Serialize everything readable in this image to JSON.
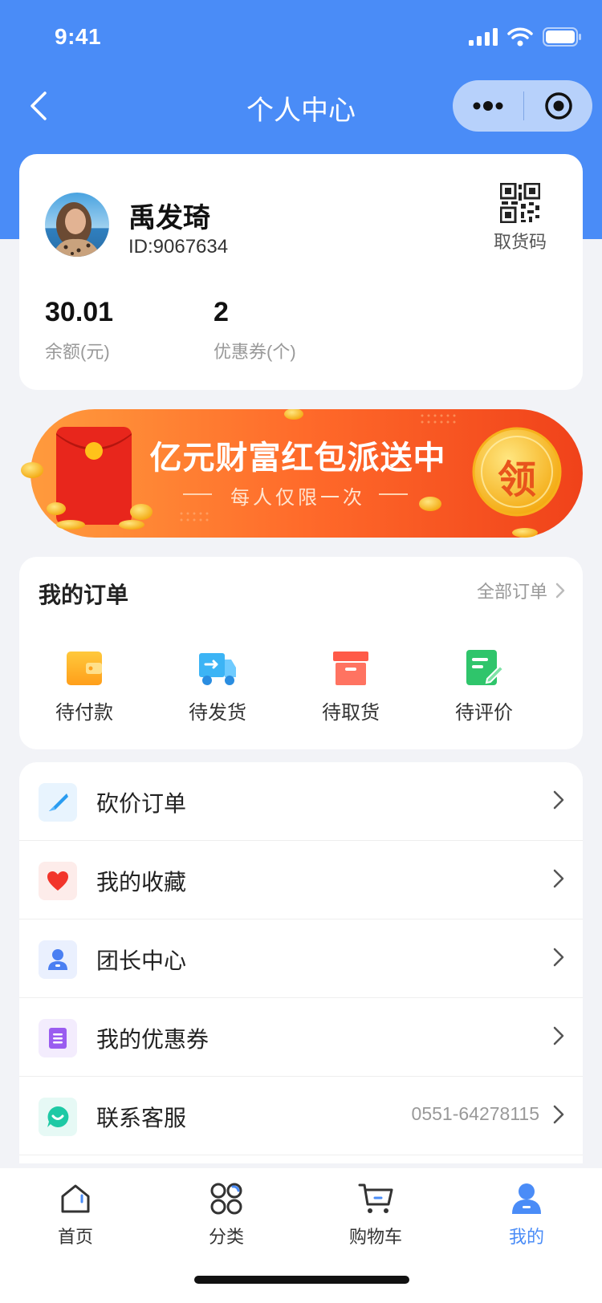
{
  "status": {
    "time": "9:41"
  },
  "nav": {
    "title": "个人中心"
  },
  "profile": {
    "name": "禹发琦",
    "id": "ID:9067634",
    "qr_label": "取货码",
    "balance_value": "30.01",
    "balance_label": "余额(元)",
    "coupon_value": "2",
    "coupon_label": "优惠券(个)"
  },
  "banner": {
    "title": "亿元财富红包派送中",
    "subtitle": "每人仅限一次",
    "badge": "领"
  },
  "orders": {
    "title": "我的订单",
    "all_label": "全部订单",
    "items": [
      {
        "label": "待付款",
        "icon": "wallet-icon"
      },
      {
        "label": "待发货",
        "icon": "truck-icon"
      },
      {
        "label": "待取货",
        "icon": "box-icon"
      },
      {
        "label": "待评价",
        "icon": "review-icon"
      }
    ]
  },
  "menu": [
    {
      "label": "砍价订单",
      "icon": "knife-icon"
    },
    {
      "label": "我的收藏",
      "icon": "heart-icon"
    },
    {
      "label": "团长中心",
      "icon": "leader-icon"
    },
    {
      "label": "我的优惠券",
      "icon": "coupon-icon"
    },
    {
      "label": "联系客服",
      "icon": "service-icon",
      "value": "0551-64278115"
    }
  ],
  "tabs": [
    {
      "label": "首页",
      "icon": "home-icon"
    },
    {
      "label": "分类",
      "icon": "category-icon"
    },
    {
      "label": "购物车",
      "icon": "cart-icon"
    },
    {
      "label": "我的",
      "icon": "profile-icon",
      "active": true
    }
  ],
  "colors": {
    "primary": "#4a8cf7",
    "background": "#f2f3f7",
    "banner_orange": "#f4511e",
    "coin_gold": "#ffc21a"
  }
}
